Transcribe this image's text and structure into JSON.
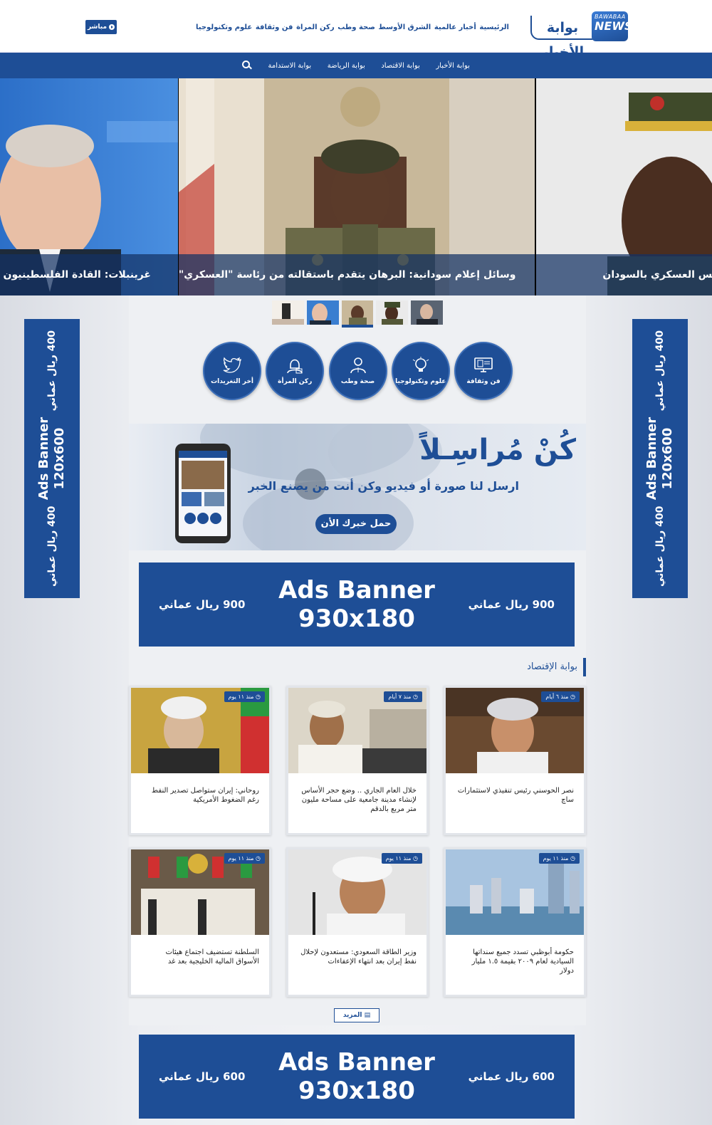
{
  "header": {
    "logo_ar": "بوابة الأخبار",
    "logo_en_top": "BAWABAA",
    "logo_en_main": "NEWS",
    "nav": [
      "الرئيسية",
      "أخبار عالمية",
      "الشرق الأوسط",
      "صحة وطب",
      "ركن المراة",
      "فن وثقافة",
      "علوم وتكنولوجيا"
    ],
    "live_label": "مباشر"
  },
  "subnav": {
    "items": [
      "بوابة الأخبار",
      "بوابة الاقتصاد",
      "بوابة الرياضة",
      "بوابة الاستدامة"
    ]
  },
  "slider": {
    "left_caption": "غرينبلات: القادة الفلسطينيون يس",
    "center_caption": "وسائل إعلام سودانية: البرهان يتقدم باستقالته من رئاسة \"العسكري\"",
    "right_caption": "س المجلس العسكري بالسودان"
  },
  "side_ads": {
    "price": "400 ريال عماني",
    "title_line1": "Ads Banner",
    "title_line2": "120x600"
  },
  "categories": [
    {
      "label": "فن وثقافة",
      "icon": "monitor-icon"
    },
    {
      "label": "علوم وتكنولوجيا",
      "icon": "bulb-icon"
    },
    {
      "label": "صحة وطب",
      "icon": "doctor-icon"
    },
    {
      "label": "ركن المرأة",
      "icon": "woman-icon"
    },
    {
      "label": "أخر التغريدات",
      "icon": "twitter-icon"
    }
  ],
  "promo": {
    "title": "كُنْ مُراسِـلاً",
    "subtitle": "ارسل لنا صورة أو فيديو وكن أنت من يصنع الخبر",
    "button": "حمل خبرك الأن"
  },
  "big_ad_1": {
    "price": "900 ريال عماني",
    "title_line1": "Ads Banner",
    "title_line2": "930x180"
  },
  "big_ad_2": {
    "price": "600 ريال عماني",
    "title_line1": "Ads Banner",
    "title_line2": "930x180"
  },
  "section": {
    "title": "بوابة الإقتصاد",
    "cards": [
      {
        "time": "منذ ٦ أيام",
        "title": "نصر الحوسني رئيس تنفيذي لاستثمارات ساچ"
      },
      {
        "time": "منذ ٧ أيام",
        "title": "خلال العام الجاري .. وضع حجر الأساس لإنشاء مدينة جامعية على مساحة مليون متر مربع بالدقم"
      },
      {
        "time": "منذ ١١ يوم",
        "title": "روحاني: إيران ستواصل تصدير النفط رغم الضغوط الأمريكية"
      },
      {
        "time": "منذ ١١ يوم",
        "title": "حكومة أبوظبي تسدد جميع سنداتها السيادية لعام ٢٠٠٩ بقيمة ١.٥ مليار دولار"
      },
      {
        "time": "منذ ١١ يوم",
        "title": "وزير الطاقة السعودي: مستعدون لإحلال نفط إيران بعد انتهاء الإعفاءات"
      },
      {
        "time": "منذ ١١ يوم",
        "title": "السلطنة تستضيف اجتماع هيئات الأسواق المالية الخليجية بعد غد"
      }
    ],
    "more_label": "المزيد"
  },
  "colors": {
    "brand_blue": "#1e4e96",
    "page_bg": "#e3e6ec"
  }
}
